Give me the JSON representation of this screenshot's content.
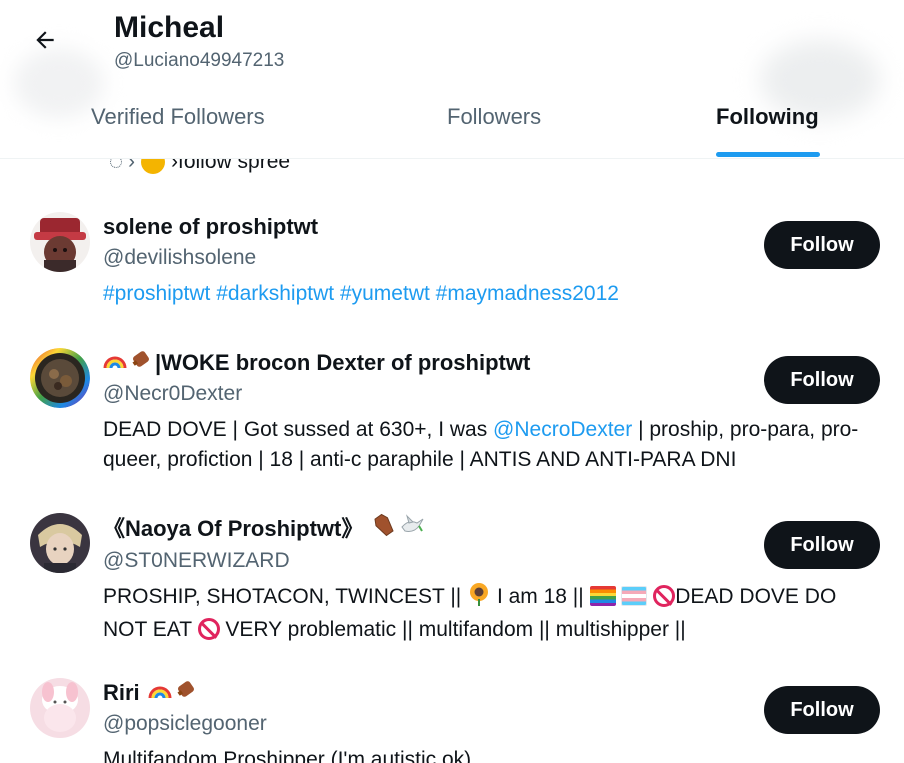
{
  "header": {
    "title": "Micheal",
    "handle": "@Luciano49947213"
  },
  "tabs": [
    {
      "label": "Verified Followers",
      "active": false
    },
    {
      "label": "Followers",
      "active": false
    },
    {
      "label": "Following",
      "active": true
    }
  ],
  "partial_bio": {
    "text": "›follow spree"
  },
  "users": [
    {
      "name": "solene of proshiptwt",
      "handle": "@devilishsolene",
      "bio": "#proshiptwt #darkshiptwt #yumetwt #maymadness2012",
      "button": "Follow"
    },
    {
      "name": "|WOKE brocon Dexter of proshiptwt",
      "handle": "@Necr0Dexter",
      "bio_before": "DEAD DOVE | Got sussed at 630+, I was ",
      "bio_mention": "@NecroDexter",
      "bio_after": " | proship, pro-para, pro-queer, profiction | 18 | anti-c paraphile | ANTIS AND ANTI-PARA DNI",
      "button": "Follow"
    },
    {
      "name": "《Naoya Of Proshiptwt》",
      "handle": "@ST0NERWIZARD",
      "bio_part1": "PROSHIP, SHOTACON, TWINCEST ||",
      "bio_part2": "I am 18 ||",
      "bio_part3": "DEAD DOVE DO NOT EAT",
      "bio_part4": "VERY problematic || multifandom || multishipper ||",
      "button": "Follow"
    },
    {
      "name": "Riri",
      "handle": "@popsiclegooner",
      "bio": "Multifandom Proshipper (I'm autistic ok)",
      "button": "Follow"
    }
  ],
  "colors": {
    "accent": "#1d9bf0",
    "button_bg": "#0f1419",
    "secondary_text": "#536471"
  }
}
